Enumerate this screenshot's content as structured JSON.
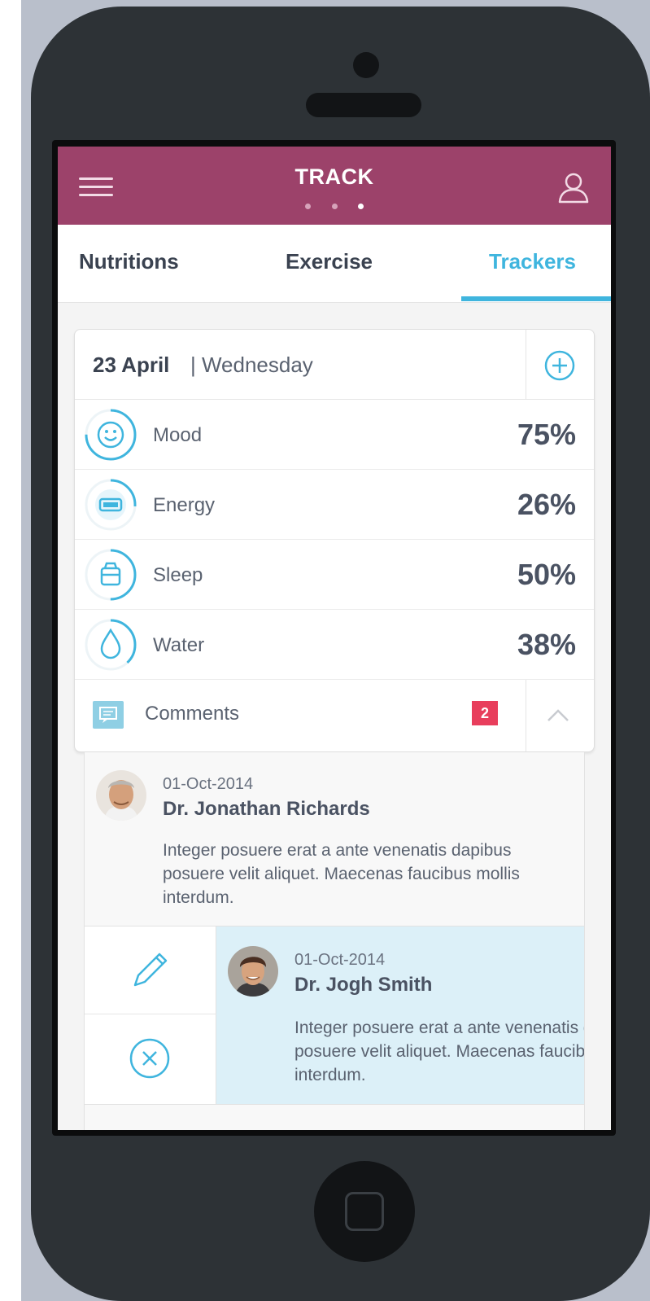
{
  "header": {
    "title": "TRACK",
    "page_dots": 3,
    "active_dot": 3
  },
  "tabs": [
    {
      "label": "Nutritions",
      "active": false
    },
    {
      "label": "Exercise",
      "active": false
    },
    {
      "label": "Trackers",
      "active": true
    }
  ],
  "card": {
    "date_strong": "23 April",
    "date_rest": "| Wednesday",
    "trackers": [
      {
        "label": "Mood",
        "value": "75%",
        "fraction": 0.75,
        "icon": "smiley-icon"
      },
      {
        "label": "Energy",
        "value": "26%",
        "fraction": 0.26,
        "icon": "battery-icon"
      },
      {
        "label": "Sleep",
        "value": "50%",
        "fraction": 0.5,
        "icon": "bed-icon"
      },
      {
        "label": "Water",
        "value": "38%",
        "fraction": 0.38,
        "icon": "water-drop-icon"
      }
    ],
    "comments_label": "Comments",
    "comments_count": "2"
  },
  "comments": [
    {
      "date": "01-Oct-2014",
      "author": "Dr. Jonathan Richards",
      "text": "Integer posuere erat a ante venenatis dapibus posuere velit aliquet. Maecenas faucibus mollis interdum."
    },
    {
      "date": "01-Oct-2014",
      "author": "Dr. Jogh Smith",
      "text": "Integer posuere erat a ante venenatis dapibus posuere velit aliquet. Maecenas faucibus mollis interdum."
    }
  ],
  "colors": {
    "header": "#9c426a",
    "accent": "#3fb5de",
    "badge": "#e83e5c",
    "swipe_highlight": "#dcf0f8"
  }
}
